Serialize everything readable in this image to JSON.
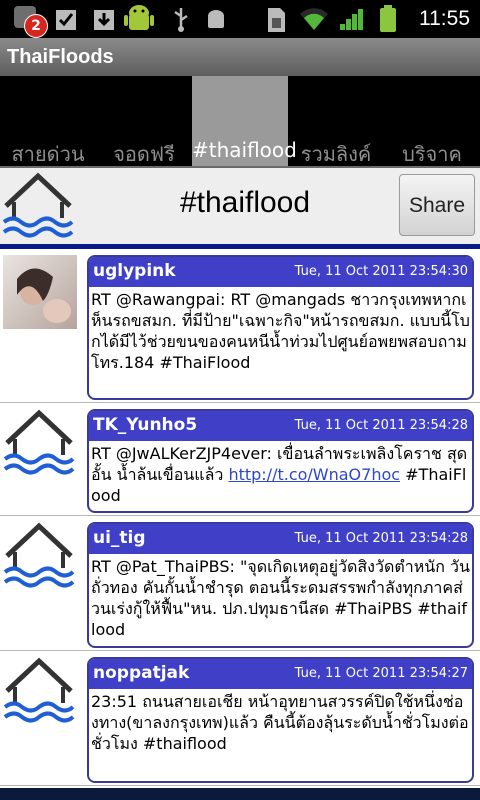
{
  "status_bar": {
    "notification_count": "2",
    "time": "11:55",
    "icons": [
      "notification-icon",
      "checkbox-icon",
      "download-icon",
      "android-icon",
      "usb-icon",
      "debug-icon",
      "sim-icon",
      "wifi-icon",
      "signal-icon",
      "battery-icon"
    ]
  },
  "app": {
    "title": "ThaiFloods"
  },
  "tabs": [
    {
      "label": "สายด่วน"
    },
    {
      "label": "จอดฟรี"
    },
    {
      "label": "#thaiflood",
      "active": true
    },
    {
      "label": "รวมลิงค์"
    },
    {
      "label": "บริจาค"
    }
  ],
  "header": {
    "title": "#thaiflood",
    "share_label": "Share"
  },
  "colors": {
    "accent_blue": "#3f3fc7",
    "divider_blue": "#0b1a8a"
  },
  "tweets": [
    {
      "user": "uglypink",
      "time": "Tue, 11 Oct 2011 23:54:30",
      "text": "RT @Rawangpai: RT @mangads ชาวกรุงเทพหากเห็นรถขสมก. ที่มีป้าย\"เฉพาะกิจ\"หน้ารถขสมก. แบบนี้โบกได้มีไว้ช่วยขนของคนหนีน้ำท่วมไปศูนย์อพยพสอบถามโทร.184 #ThaiFlood",
      "link": ""
    },
    {
      "user": "TK_Yunho5",
      "time": "Tue, 11 Oct 2011 23:54:28",
      "text": "RT @JwALKerZJP4ever: เขื่อนลำพระเพลิงโคราช สุดอั้น น้ำล้นเขื่อนแล้ว ",
      "link": "http://t.co/WnaO7hoc",
      "text_after": " #ThaiFlood"
    },
    {
      "user": "ui_tig",
      "time": "Tue, 11 Oct 2011 23:54:28",
      "text": "RT @Pat_ThaiPBS: \"จุดเกิดเหตุอยู่วัดสิงวัดตำหนัก วันถั่วทอง คันกั้นน้ำชำรุด ตอนนี้ระดมสรรพกำลังทุกภาคส่วนเร่งกู้ให้ฟื้น\"หน. ปภ.ปทุมธานีสด #ThaiPBS #thaiflood",
      "link": ""
    },
    {
      "user": "noppatjak",
      "time": "Tue, 11 Oct 2011 23:54:27",
      "text": "23:51 ถนนสายเอเชีย หน้าอุทยานสวรรค์ปิดใช้หนึ่งช่องทาง(ขาลงกรุงเทพ)แล้ว คืนนี้ต้องลุ้นระดับน้ำชั่วโมงต่อชั่วโมง #thaiflood",
      "link": ""
    }
  ]
}
